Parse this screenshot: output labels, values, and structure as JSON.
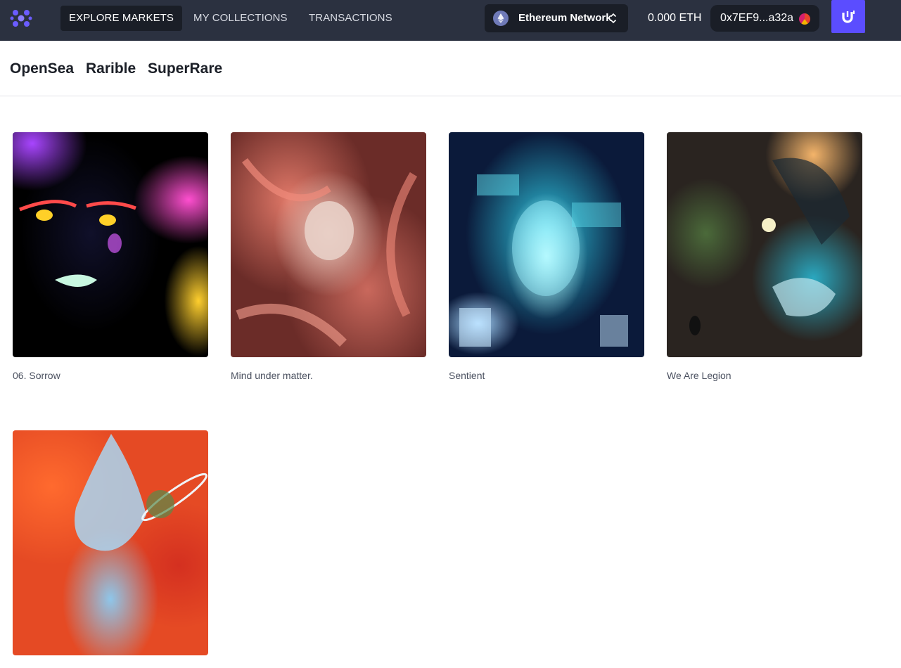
{
  "nav": {
    "items": [
      {
        "label": "EXPLORE MARKETS",
        "active": true
      },
      {
        "label": "MY COLLECTIONS",
        "active": false
      },
      {
        "label": "TRANSACTIONS",
        "active": false
      }
    ],
    "network": "Ethereum Network",
    "balance": "0.000 ETH",
    "wallet_address": "0x7EF9...a32a",
    "accent_color": "#5b4dff"
  },
  "markets": {
    "tabs": [
      "OpenSea",
      "Rarible",
      "SuperRare"
    ]
  },
  "collection": {
    "items": [
      {
        "title": "06. Sorrow",
        "image": "artwork-sorrow"
      },
      {
        "title": "Mind under matter.",
        "image": "artwork-mind-under-matter"
      },
      {
        "title": "Sentient",
        "image": "artwork-sentient"
      },
      {
        "title": "We Are Legion",
        "image": "artwork-we-are-legion"
      },
      {
        "title": "",
        "image": "artwork-blue-figure"
      }
    ]
  }
}
